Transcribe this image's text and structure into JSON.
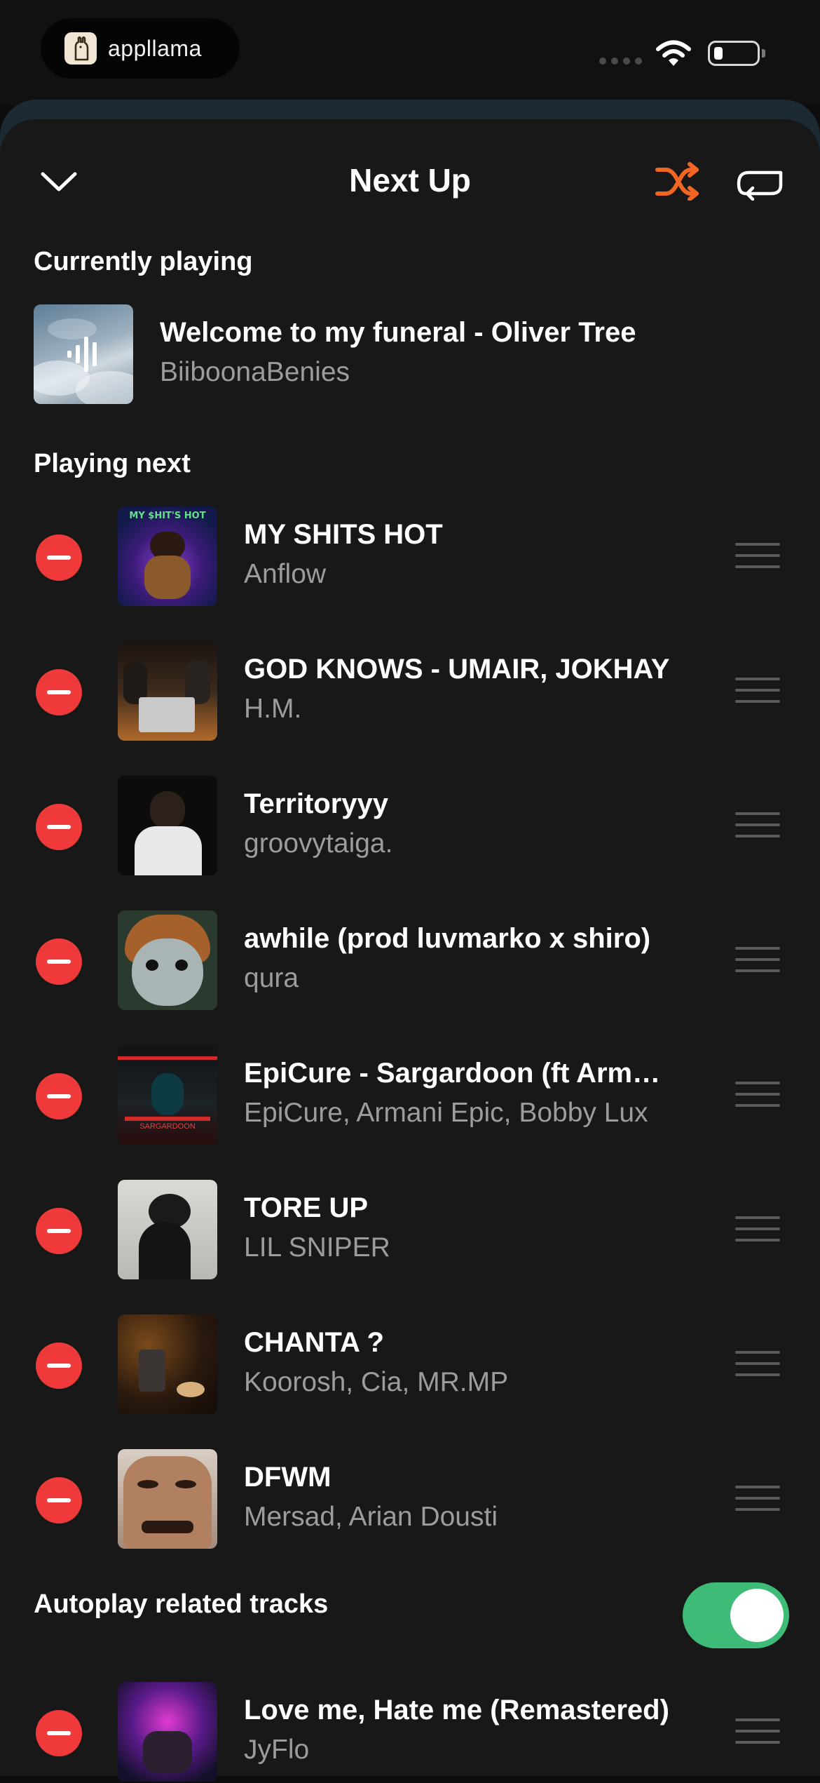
{
  "status_bar": {
    "app_name": "appllama"
  },
  "header": {
    "title": "Next Up",
    "shuffle_color": "#f26522"
  },
  "currently_playing": {
    "section_label": "Currently playing",
    "title": "Welcome to my funeral - Oliver Tree",
    "artist": "BiiboonaBenies"
  },
  "playing_next": {
    "section_label": "Playing next",
    "items": [
      {
        "title": "MY SHITS HOT",
        "artist": "Anflow",
        "cover_text": "MY $HIT'S HOT"
      },
      {
        "title": "GOD KNOWS - UMAIR, JOKHAY",
        "artist": "H.M."
      },
      {
        "title": "Territoryyy",
        "artist": "groovytaiga."
      },
      {
        "title": "awhile (prod luvmarko x shiro)",
        "artist": "qura"
      },
      {
        "title": "EpiCure - Sargardoon (ft Armani Epic)",
        "artist": "EpiCure, Armani Epic, Bobby Lux",
        "cover_text": "SARGARDOON"
      },
      {
        "title": "TORE UP",
        "artist": "LIL SNIPER"
      },
      {
        "title": "CHANTA ?",
        "artist": "Koorosh, Cia, MR.MP"
      },
      {
        "title": "DFWM",
        "artist": "Mersad, Arian Dousti"
      }
    ]
  },
  "autoplay": {
    "label": "Autoplay related tracks",
    "enabled": true,
    "toggle_color": "#3dbb77",
    "items": [
      {
        "title": "Love me, Hate me (Remastered)",
        "artist": "JyFlo"
      }
    ]
  }
}
